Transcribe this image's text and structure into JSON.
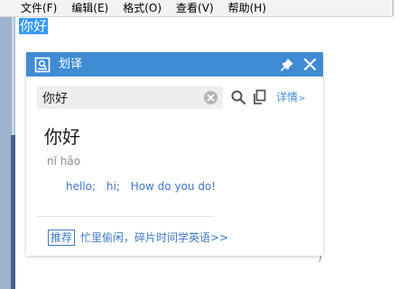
{
  "menubar": {
    "items": [
      {
        "label": "文件(F)"
      },
      {
        "label": "编辑(E)"
      },
      {
        "label": "格式(O)"
      },
      {
        "label": "查看(V)"
      },
      {
        "label": "帮助(H)"
      }
    ]
  },
  "editor": {
    "selected_text": "你好",
    "trailing_mark": ")"
  },
  "popup": {
    "title": "划译",
    "search": {
      "value": "你好",
      "details_label": "详情",
      "details_chevron": ">"
    },
    "headword": "你好",
    "pinyin": "nǐ hǎo",
    "translations": [
      "hello;",
      "hi;",
      "How do you do!"
    ],
    "recommend_badge": "推荐",
    "recommend_text": "忙里偷闲，碎片时间学英语>>"
  },
  "icons": {
    "logo": "dictionary-logo-icon",
    "pin": "pin-icon",
    "close": "close-icon",
    "clear": "clear-icon",
    "search": "search-icon",
    "copy": "copy-icon"
  },
  "colors": {
    "header_blue": "#3f8bd4",
    "link_blue": "#3f76c3",
    "selection_blue": "#3399ff"
  }
}
